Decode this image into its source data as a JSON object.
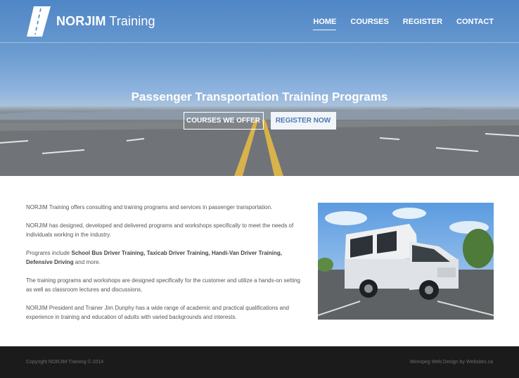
{
  "brand": {
    "name_bold": "NORJIM",
    "name_light": "Training"
  },
  "nav": [
    {
      "label": "HOME",
      "active": true
    },
    {
      "label": "COURSES"
    },
    {
      "label": "REGISTER"
    },
    {
      "label": "CONTACT"
    }
  ],
  "hero": {
    "title": "Passenger Transportation Training Programs",
    "btn_courses": "COURSES WE OFFER",
    "btn_register": "REGISTER NOW"
  },
  "content": {
    "p1": "NORJIM Training offers consulting and training programs and services in passenger transportation.",
    "p2": "NORJIM has designed, developed and delivered programs and workshops specifically to meet the needs of individuals working in the industry.",
    "p3_prefix": "Programs include ",
    "p3_bold": "School Bus Driver Training, Taxicab Driver Training, Handi-Van Driver Training, Defensive Driving",
    "p3_suffix": " and more.",
    "p4": "The training programs and workshops are designed specifically for the customer and utilize a hands-on setting as well as classroom lectures and discussions.",
    "p5": "NORJIM President and Trainer Jim Dunphy has a wide range of academic and practical qualifications and experience in training and education of adults with varied backgrounds and interests."
  },
  "footer": {
    "copyright": "Copyright NORJIM Training © 2014",
    "credit": "Winnipeg Web Design by Websites.ca"
  },
  "colors": {
    "sky": "#4f86c6",
    "footer_bg": "#1b1b1b",
    "button_text": "#4a7ab5"
  }
}
